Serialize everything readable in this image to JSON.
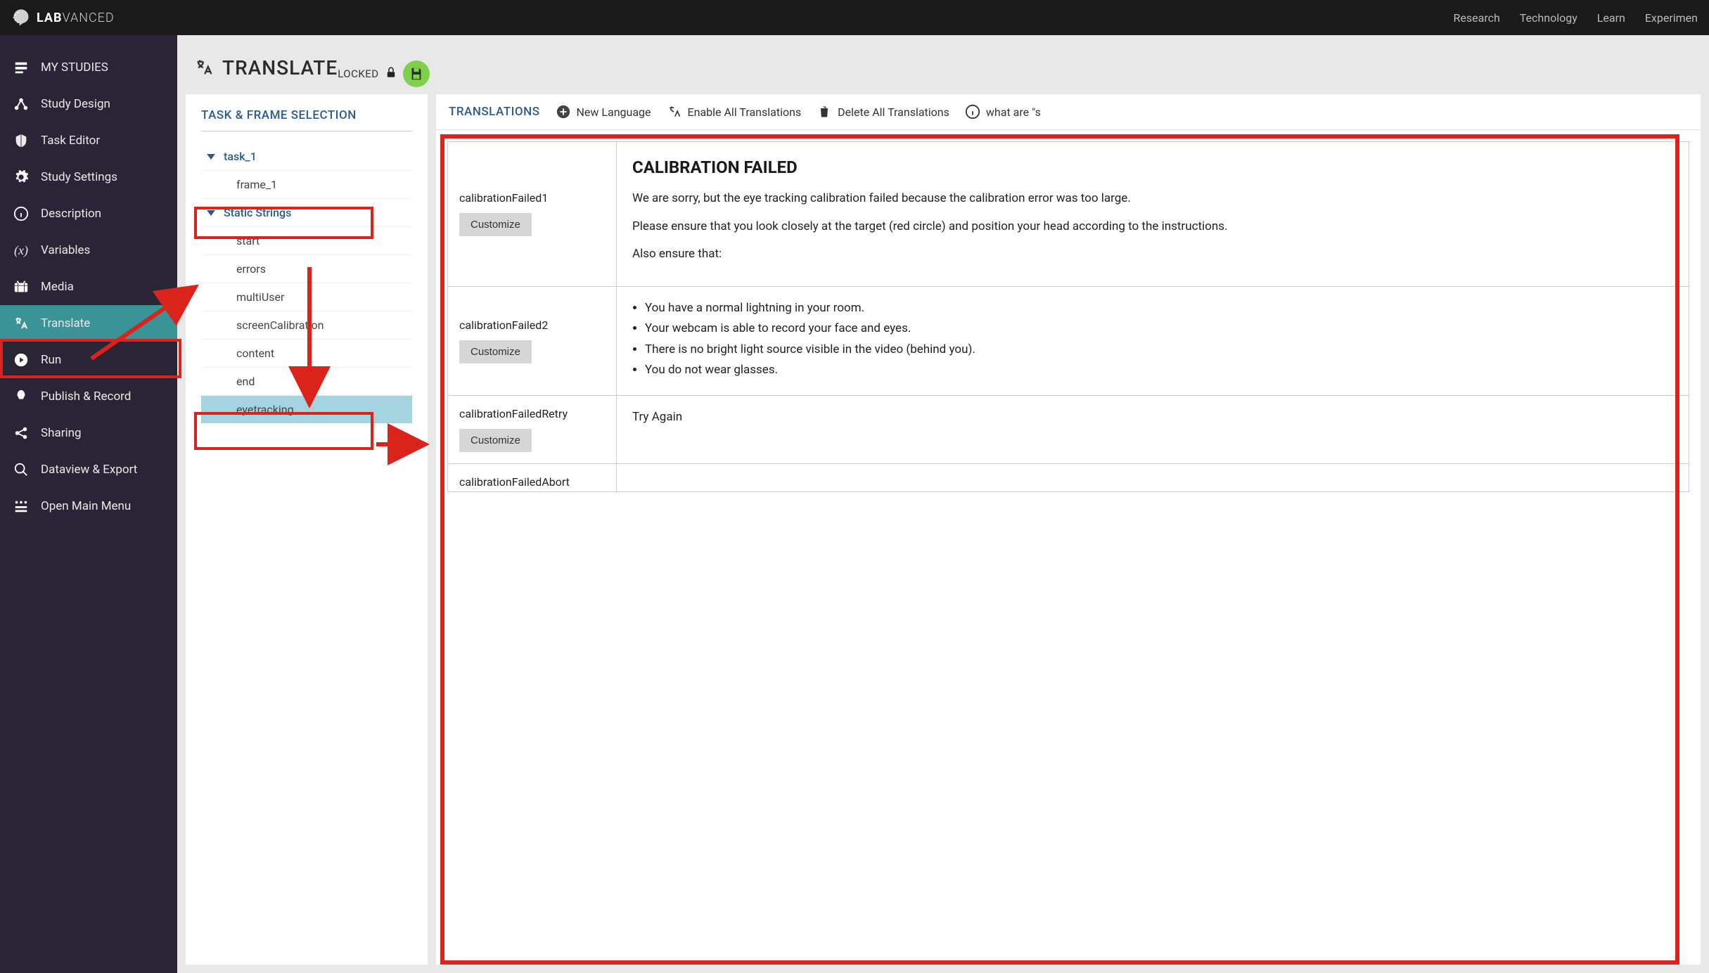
{
  "brand": {
    "bold": "LAB",
    "light": "VANCED"
  },
  "topNav": {
    "research": "Research",
    "technology": "Technology",
    "learn": "Learn",
    "experiment": "Experimen"
  },
  "sidebar": {
    "myStudies": "MY STUDIES",
    "studyDesign": "Study Design",
    "taskEditor": "Task Editor",
    "studySettings": "Study Settings",
    "description": "Description",
    "variables": "Variables",
    "media": "Media",
    "translate": "Translate",
    "run": "Run",
    "publishRecord": "Publish & Record",
    "sharing": "Sharing",
    "dataview": "Dataview & Export",
    "openMainMenu": "Open Main Menu"
  },
  "page": {
    "title": "TRANSLATE",
    "locked": "LOCKED"
  },
  "leftPanel": {
    "heading": "TASK & FRAME SELECTION",
    "task1": "task_1",
    "frame1": "frame_1",
    "staticStrings": "Static Strings",
    "start": "start",
    "errors": "errors",
    "multiUser": "multiUser",
    "screenCalibration": "screenCalibration",
    "content": "content",
    "end": "end",
    "eyetracking": "eyetracking"
  },
  "rightPanel": {
    "heading": "TRANSLATIONS",
    "newLanguage": "New Language",
    "enableAll": "Enable All Translations",
    "deleteAll": "Delete All Translations",
    "whatAre": "what are \"s",
    "customize": "Customize",
    "row1": {
      "key": "calibrationFailed1",
      "title": "CALIBRATION FAILED",
      "p1": "We are sorry, but the eye tracking calibration failed because the calibration error was too large.",
      "p2": "Please ensure that you look closely at the target (red circle) and position your head according to the instructions.",
      "p3": "Also ensure that:"
    },
    "row2": {
      "key": "calibrationFailed2",
      "li1": "You have a normal lightning in your room.",
      "li2": "Your webcam is able to record your face and eyes.",
      "li3": "There is no bright light source visible in the video (behind you).",
      "li4": "You do not wear glasses."
    },
    "row3": {
      "key": "calibrationFailedRetry",
      "text": "Try Again"
    },
    "row4": {
      "key": "calibrationFailedAbort"
    }
  }
}
